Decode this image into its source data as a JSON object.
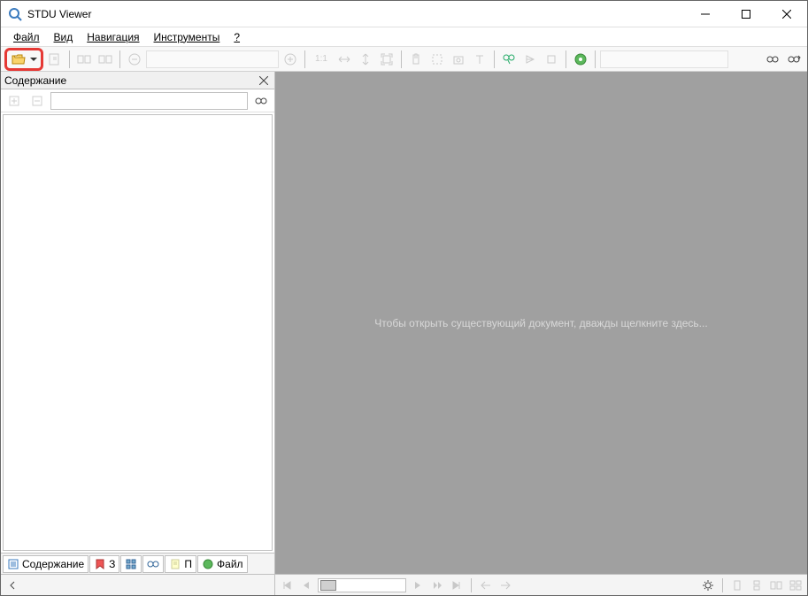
{
  "titlebar": {
    "title": "STDU Viewer"
  },
  "menu": {
    "file": "Файл",
    "view": "Вид",
    "navigation": "Навигация",
    "tools": "Инструменты",
    "help": "?"
  },
  "toolbar": {
    "zoom_label": "1:1",
    "zoom_value": "",
    "page_value": "",
    "search_value": ""
  },
  "side_panel": {
    "title": "Содержание",
    "search_placeholder": "",
    "tabs": {
      "contents": "Содержание",
      "bookmarks": "З",
      "search": "",
      "pages": "П",
      "file": "Файл"
    }
  },
  "main": {
    "placeholder": "Чтобы открыть существующий документ, дважды щелкните здесь..."
  },
  "status": {
    "page_scroll": ""
  }
}
